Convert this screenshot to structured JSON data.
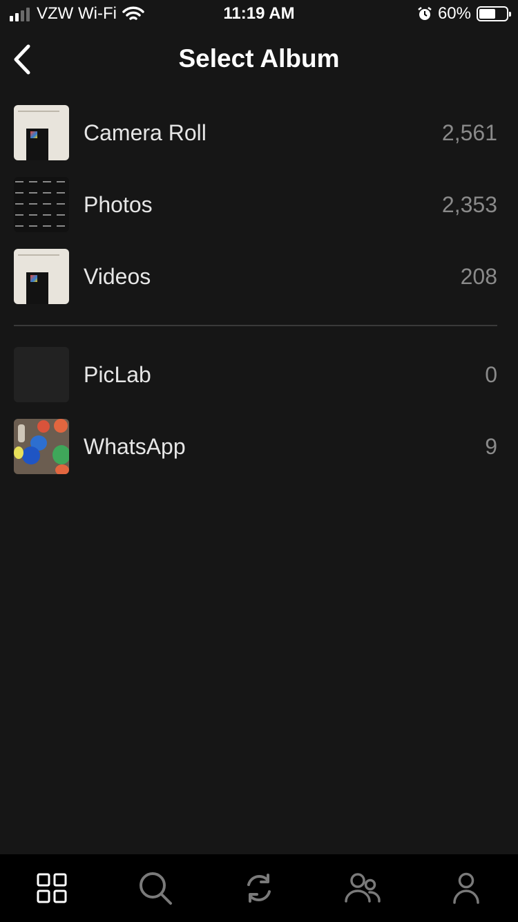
{
  "status_bar": {
    "carrier": "VZW Wi-Fi",
    "time": "11:19 AM",
    "battery_percent": "60%",
    "battery_level": 0.6,
    "signal_bars_filled": 2,
    "signal_bars_total": 4
  },
  "header": {
    "title": "Select Album"
  },
  "albums": [
    {
      "name": "Camera Roll",
      "count": "2,561",
      "thumb": "screenshot"
    },
    {
      "name": "Photos",
      "count": "2,353",
      "thumb": "grid"
    },
    {
      "name": "Videos",
      "count": "208",
      "thumb": "screenshot"
    }
  ],
  "user_albums": [
    {
      "name": "PicLab",
      "count": "0",
      "thumb": "empty"
    },
    {
      "name": "WhatsApp",
      "count": "9",
      "thumb": "photo"
    }
  ],
  "tabs": [
    {
      "icon": "grid-icon"
    },
    {
      "icon": "search-icon"
    },
    {
      "icon": "refresh-icon"
    },
    {
      "icon": "people-icon"
    },
    {
      "icon": "profile-icon"
    }
  ]
}
